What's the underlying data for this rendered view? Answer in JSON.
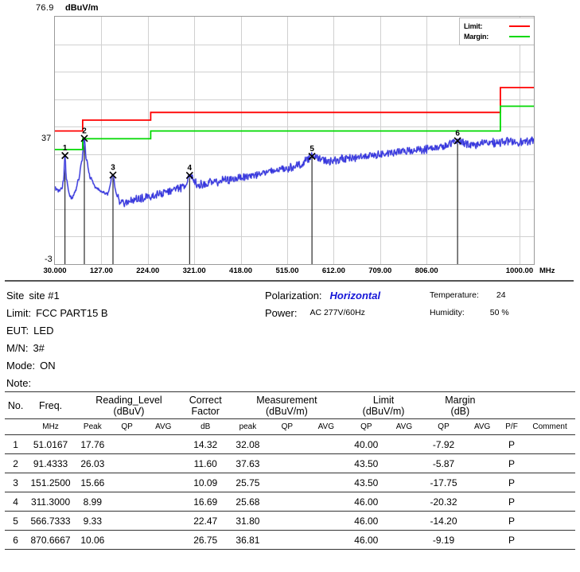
{
  "chart_data": {
    "type": "line",
    "title": "",
    "xlabel": "MHz",
    "ylabel": "dBuV/m",
    "y_top_label": "76.9",
    "y_mid_label": "37",
    "y_bottom_label": "-3",
    "ylim": [
      -3,
      76.9
    ],
    "xlim": [
      30,
      1030
    ],
    "x_unit": "MHz",
    "y_unit": "dBuV/m",
    "grid": true,
    "legend_position": "top-right",
    "x_ticks": [
      "30.000",
      "127.00",
      "224.00",
      "321.00",
      "418.00",
      "515.00",
      "612.00",
      "709.00",
      "806.00",
      "1000.00"
    ],
    "x_tick_values": [
      30,
      127,
      224,
      321,
      418,
      515,
      612,
      709,
      806,
      1000
    ],
    "legend": [
      {
        "name": "Limit:",
        "color": "#ff0000"
      },
      {
        "name": "Margin:",
        "color": "#00d900"
      }
    ],
    "series": [
      {
        "name": "Limit",
        "color": "#ff0000",
        "type": "step",
        "points": [
          [
            30,
            40.0
          ],
          [
            88,
            40.0
          ],
          [
            88,
            43.5
          ],
          [
            230,
            43.5
          ],
          [
            230,
            46.0
          ],
          [
            960,
            46.0
          ],
          [
            960,
            54.0
          ],
          [
            1030,
            54.0
          ]
        ]
      },
      {
        "name": "Margin",
        "color": "#00d900",
        "type": "step",
        "points": [
          [
            30,
            34.0
          ],
          [
            88,
            34.0
          ],
          [
            88,
            37.5
          ],
          [
            230,
            37.5
          ],
          [
            230,
            40.0
          ],
          [
            960,
            40.0
          ],
          [
            960,
            48.0
          ],
          [
            1030,
            48.0
          ]
        ]
      },
      {
        "name": "Trace",
        "color": "#3333dd",
        "type": "noisy-trace"
      }
    ],
    "markers": [
      {
        "no": "1",
        "freq": 51.0167,
        "level": 32.08
      },
      {
        "no": "2",
        "freq": 91.4333,
        "level": 37.63
      },
      {
        "no": "3",
        "freq": 151.25,
        "level": 25.75
      },
      {
        "no": "4",
        "freq": 311.3,
        "level": 25.68
      },
      {
        "no": "5",
        "freq": 566.7333,
        "level": 31.8
      },
      {
        "no": "6",
        "freq": 870.6667,
        "level": 36.81
      }
    ]
  },
  "info": {
    "left": [
      {
        "label": "Site",
        "value": "site #1"
      },
      {
        "label": "Limit:",
        "value": "FCC PART15 B"
      },
      {
        "label": "EUT:",
        "value": "LED"
      },
      {
        "label": "M/N:",
        "value": "3#"
      },
      {
        "label": "Mode:",
        "value": "ON"
      },
      {
        "label": "Note:",
        "value": ""
      }
    ],
    "middle": [
      {
        "label": "Polarization:",
        "value": "Horizontal",
        "emphasis": true
      },
      {
        "label": "Power:",
        "value": "AC 277V/60Hz",
        "emphasis": false
      }
    ],
    "right": [
      {
        "label": "Temperature:",
        "value": "24"
      },
      {
        "label": "Humidity:",
        "value": "50 %"
      }
    ]
  },
  "table": {
    "group_headers": [
      {
        "line1": "No.",
        "line2": ""
      },
      {
        "line1": "Freq.",
        "line2": ""
      },
      {
        "line1": "Reading_Level",
        "line2": "(dBuV)"
      },
      {
        "line1": "Correct",
        "line2": "Factor"
      },
      {
        "line1": "Measurement",
        "line2": "(dBuV/m)"
      },
      {
        "line1": "Limit",
        "line2": "(dBuV/m)"
      },
      {
        "line1": "Margin",
        "line2": "(dB)"
      },
      {
        "line1": "",
        "line2": ""
      }
    ],
    "sub_headers": [
      "",
      "MHz",
      "Peak",
      "QP",
      "AVG",
      "dB",
      "peak",
      "QP",
      "AVG",
      "QP",
      "AVG",
      "QP",
      "AVG",
      "P/F",
      "Comment"
    ],
    "rows": [
      {
        "no": "1",
        "freq": "51.0167",
        "peak": "17.76",
        "qp": "",
        "avg": "",
        "cf": "14.32",
        "mpeak": "32.08",
        "mqp": "",
        "mavg": "",
        "lqp": "40.00",
        "lavg": "",
        "gqp": "-7.92",
        "gavg": "",
        "pf": "P",
        "comment": ""
      },
      {
        "no": "2",
        "freq": "91.4333",
        "peak": "26.03",
        "qp": "",
        "avg": "",
        "cf": "11.60",
        "mpeak": "37.63",
        "mqp": "",
        "mavg": "",
        "lqp": "43.50",
        "lavg": "",
        "gqp": "-5.87",
        "gavg": "",
        "pf": "P",
        "comment": ""
      },
      {
        "no": "3",
        "freq": "151.2500",
        "peak": "15.66",
        "qp": "",
        "avg": "",
        "cf": "10.09",
        "mpeak": "25.75",
        "mqp": "",
        "mavg": "",
        "lqp": "43.50",
        "lavg": "",
        "gqp": "-17.75",
        "gavg": "",
        "pf": "P",
        "comment": ""
      },
      {
        "no": "4",
        "freq": "311.3000",
        "peak": "8.99",
        "qp": "",
        "avg": "",
        "cf": "16.69",
        "mpeak": "25.68",
        "mqp": "",
        "mavg": "",
        "lqp": "46.00",
        "lavg": "",
        "gqp": "-20.32",
        "gavg": "",
        "pf": "P",
        "comment": ""
      },
      {
        "no": "5",
        "freq": "566.7333",
        "peak": "9.33",
        "qp": "",
        "avg": "",
        "cf": "22.47",
        "mpeak": "31.80",
        "mqp": "",
        "mavg": "",
        "lqp": "46.00",
        "lavg": "",
        "gqp": "-14.20",
        "gavg": "",
        "pf": "P",
        "comment": ""
      },
      {
        "no": "6",
        "freq": "870.6667",
        "peak": "10.06",
        "qp": "",
        "avg": "",
        "cf": "26.75",
        "mpeak": "36.81",
        "mqp": "",
        "mavg": "",
        "lqp": "46.00",
        "lavg": "",
        "gqp": "-9.19",
        "gavg": "",
        "pf": "P",
        "comment": ""
      }
    ]
  },
  "colors": {
    "limit": "#ff0000",
    "margin": "#00d900",
    "trace": "#3333dd",
    "grid": "#d0d0d0",
    "frame": "#9a9a9a",
    "emphasis": "#1616d8"
  }
}
